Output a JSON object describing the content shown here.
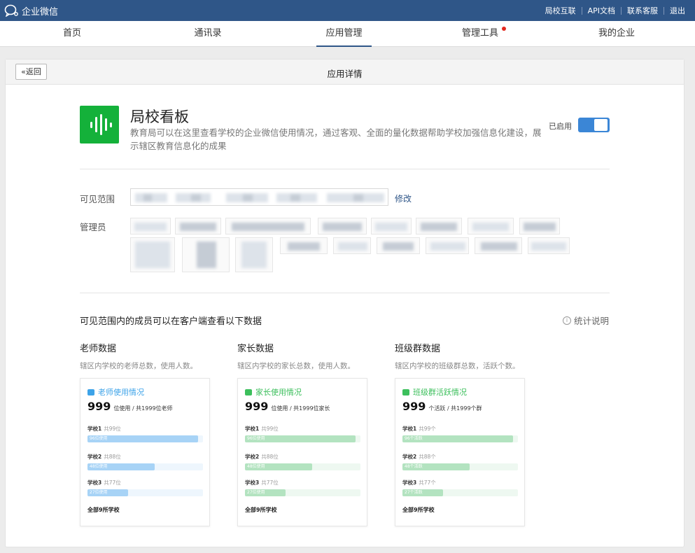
{
  "topbar": {
    "brand": "企业微信",
    "links": [
      "局校互联",
      "API文档",
      "联系客服",
      "退出"
    ]
  },
  "nav": {
    "items": [
      "首页",
      "通讯录",
      "应用管理",
      "管理工具",
      "我的企业"
    ],
    "active": "应用管理"
  },
  "page": {
    "back_label": "«返回",
    "title": "应用详情"
  },
  "app": {
    "name": "局校看板",
    "description": "教育局可以在这里查看学校的企业微信使用情况，通过客观、全面的量化数据帮助学校加强信息化建设，展示辖区教育信息化的成果",
    "status_label": "已启用",
    "enabled": true,
    "icon_color": "#14b13a"
  },
  "fields": {
    "scope_label": "可见范围",
    "modify_label": "修改",
    "admin_label": "管理员"
  },
  "section": {
    "title": "可见范围内的成员可以在客户端查看以下数据",
    "stat_link": "统计说明"
  },
  "columns": [
    {
      "title": "老师数据",
      "desc": "辖区内学校的老师总数，使用人数。",
      "panel_head": "老师使用情况",
      "big_num": "999",
      "big_sub": "位使用 / 共1999位老师",
      "color": "#3da3e8",
      "bar_color": "#a7d3f6",
      "track_color": "#eef6fd",
      "rows": [
        {
          "label": "学校1",
          "total": "共99位",
          "fill_text": "96位使用",
          "ratio": 0.96
        },
        {
          "label": "学校2",
          "total": "共88位",
          "fill_text": "48位使用",
          "ratio": 0.58
        },
        {
          "label": "学校3",
          "total": "共77位",
          "fill_text": "27位使用",
          "ratio": 0.35
        }
      ],
      "footer": "全部9所学校"
    },
    {
      "title": "家长数据",
      "desc": "辖区内学校的家长总数，使用人数。",
      "panel_head": "家长使用情况",
      "big_num": "999",
      "big_sub": "位使用 / 共1999位家长",
      "color": "#3cbf5c",
      "bar_color": "#b3e3c0",
      "track_color": "#eef8f1",
      "rows": [
        {
          "label": "学校1",
          "total": "共99位",
          "fill_text": "96位使用",
          "ratio": 0.96
        },
        {
          "label": "学校2",
          "total": "共88位",
          "fill_text": "48位使用",
          "ratio": 0.58
        },
        {
          "label": "学校3",
          "total": "共77位",
          "fill_text": "27位使用",
          "ratio": 0.35
        }
      ],
      "footer": "全部9所学校"
    },
    {
      "title": "班级群数据",
      "desc": "辖区内学校的班级群总数，活跃个数。",
      "panel_head": "班级群活跃情况",
      "big_num": "999",
      "big_sub": "个活跃 / 共1999个群",
      "color": "#3cbf5c",
      "bar_color": "#b3e3c0",
      "track_color": "#eef8f1",
      "rows": [
        {
          "label": "学校1",
          "total": "共99个",
          "fill_text": "96个活跃",
          "ratio": 0.96
        },
        {
          "label": "学校2",
          "total": "共88个",
          "fill_text": "48个活跃",
          "ratio": 0.58
        },
        {
          "label": "学校3",
          "total": "共77个",
          "fill_text": "27个活跃",
          "ratio": 0.35
        }
      ],
      "footer": "全部9所学校"
    }
  ]
}
